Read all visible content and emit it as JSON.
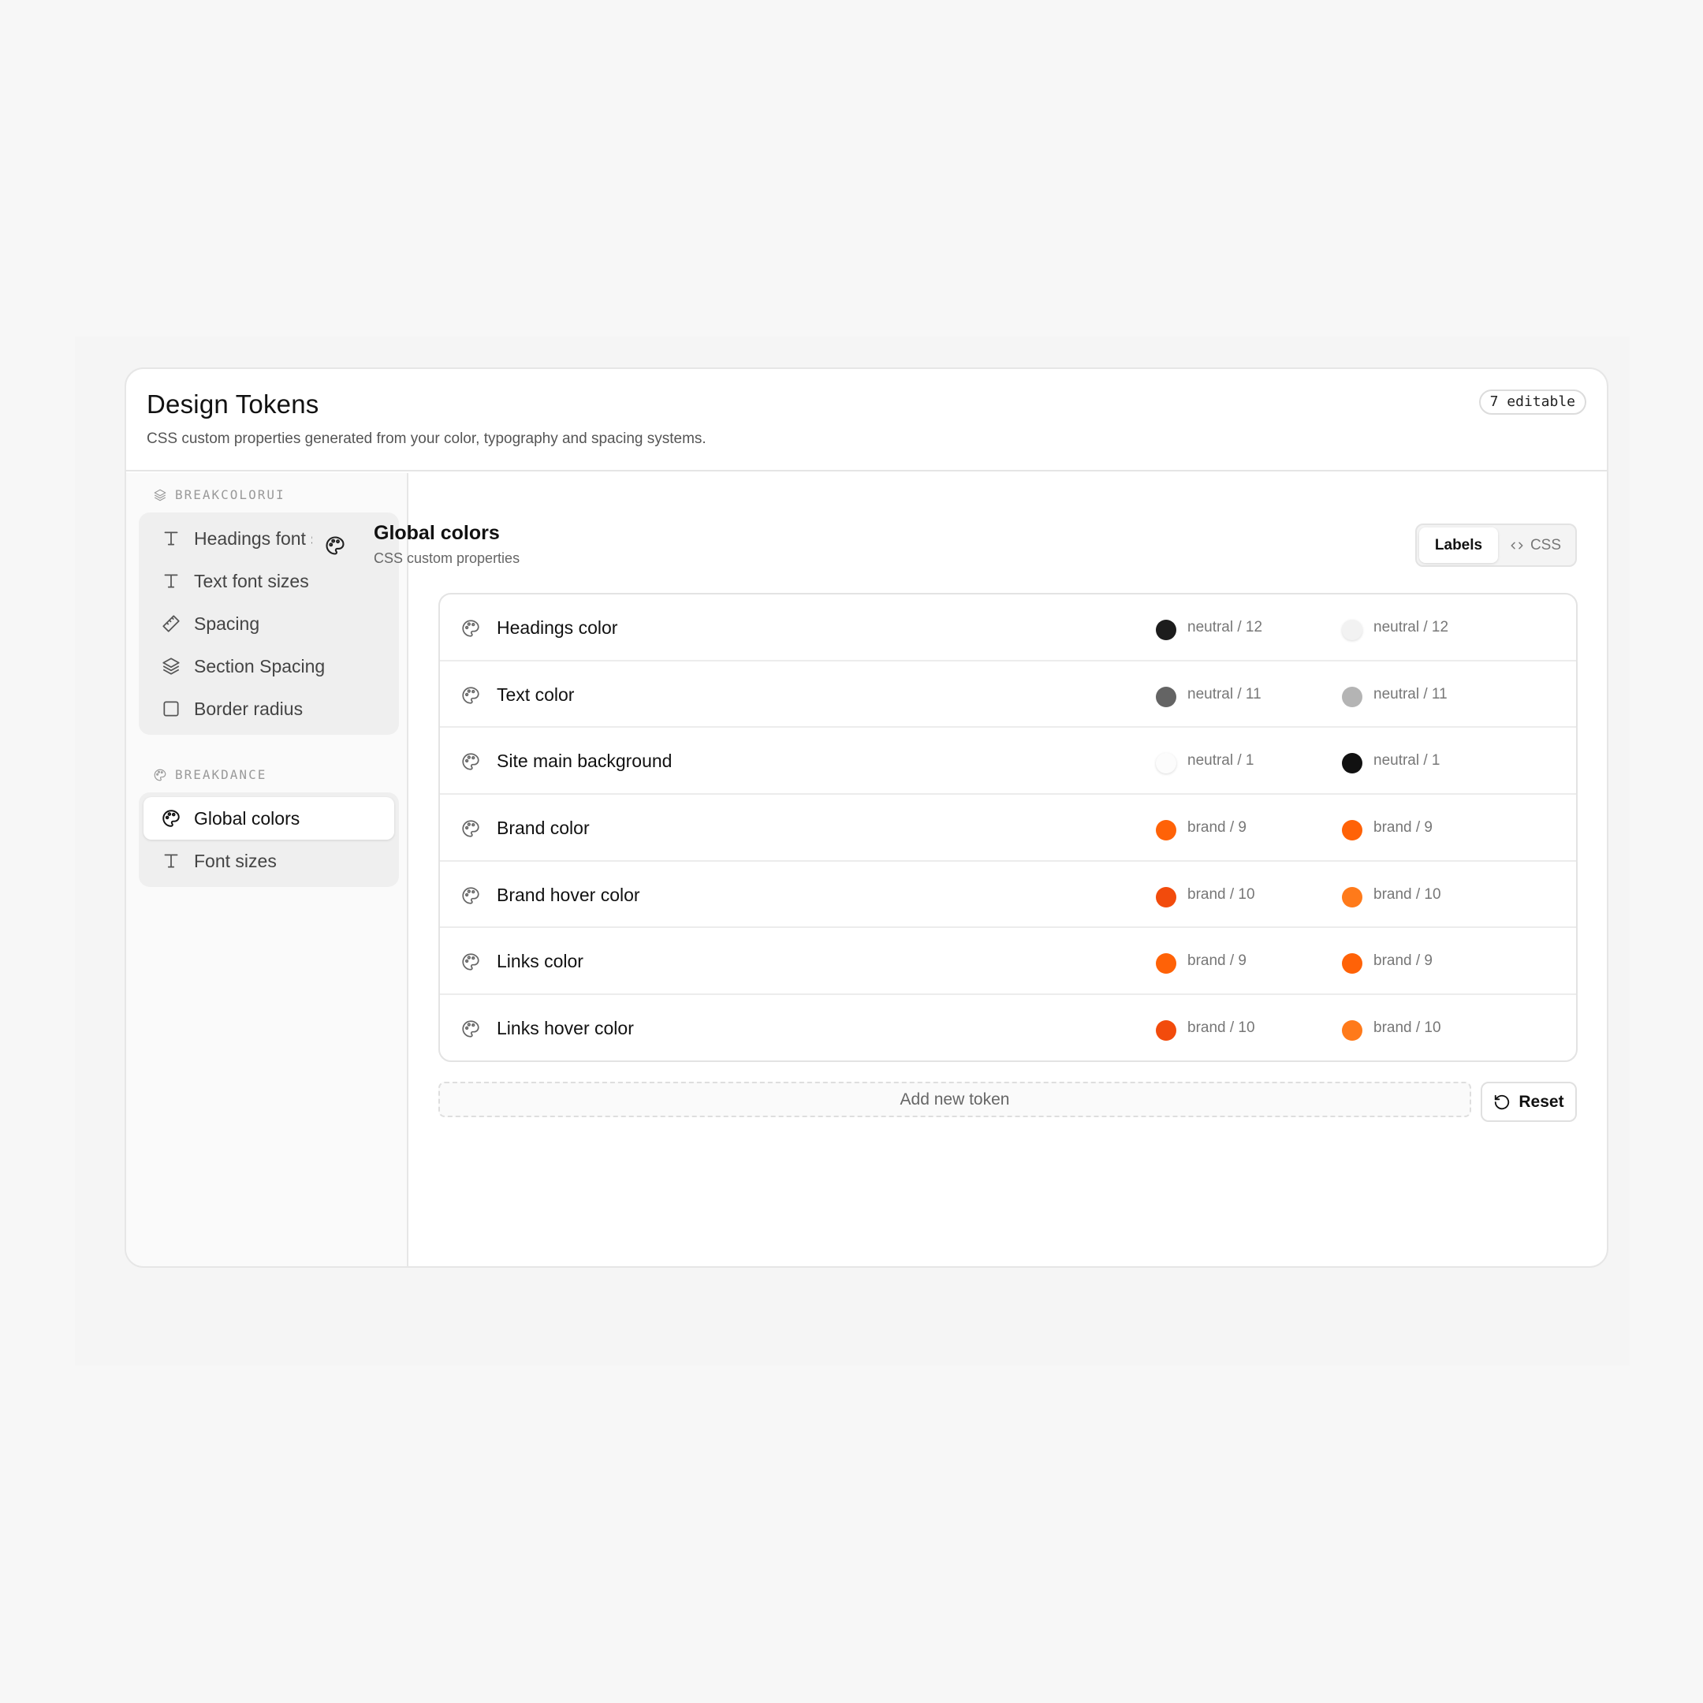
{
  "header": {
    "title": "Design Tokens",
    "subtitle": "CSS custom properties generated from your color, typography and spacing systems.",
    "badge": "7 editable"
  },
  "sidebar": {
    "groups": [
      {
        "label": "BREAKCOLORUI",
        "icon": "layers-icon",
        "items": [
          {
            "label": "Headings font size",
            "icon": "type-icon"
          },
          {
            "label": "Text font sizes",
            "icon": "type-icon"
          },
          {
            "label": "Spacing",
            "icon": "ruler-icon"
          },
          {
            "label": "Section Spacing",
            "icon": "layers-icon"
          },
          {
            "label": "Border radius",
            "icon": "square-icon"
          }
        ]
      },
      {
        "label": "BREAKDANCE",
        "icon": "palette-icon",
        "items": [
          {
            "label": "Global colors",
            "icon": "palette-icon",
            "active": true
          },
          {
            "label": "Font sizes",
            "icon": "type-icon"
          }
        ]
      }
    ]
  },
  "panel": {
    "title": "Global colors",
    "subtitle": "CSS custom properties",
    "toggle": {
      "active": "Labels",
      "inactive": "CSS"
    }
  },
  "tokens": [
    {
      "name": "Headings color",
      "light": {
        "label": "neutral / 12",
        "color": "#1c1c1c"
      },
      "dark": {
        "label": "neutral / 12",
        "color": "#f2f2f2"
      }
    },
    {
      "name": "Text color",
      "light": {
        "label": "neutral / 11",
        "color": "#646464"
      },
      "dark": {
        "label": "neutral / 11",
        "color": "#b4b4b4"
      }
    },
    {
      "name": "Site main background",
      "light": {
        "label": "neutral / 1",
        "color": "#fcfcfc"
      },
      "dark": {
        "label": "neutral / 1",
        "color": "#111111"
      }
    },
    {
      "name": "Brand color",
      "light": {
        "label": "brand / 9",
        "color": "#ff6207"
      },
      "dark": {
        "label": "brand / 9",
        "color": "#ff6207"
      }
    },
    {
      "name": "Brand hover color",
      "light": {
        "label": "brand / 10",
        "color": "#f24b0c"
      },
      "dark": {
        "label": "brand / 10",
        "color": "#ff7a1a"
      }
    },
    {
      "name": "Links color",
      "light": {
        "label": "brand / 9",
        "color": "#ff6207"
      },
      "dark": {
        "label": "brand / 9",
        "color": "#ff6207"
      }
    },
    {
      "name": "Links hover color",
      "light": {
        "label": "brand / 10",
        "color": "#f24b0c"
      },
      "dark": {
        "label": "brand / 10",
        "color": "#ff7a1a"
      }
    }
  ],
  "actions": {
    "add_token": "Add new token",
    "reset": "Reset"
  }
}
